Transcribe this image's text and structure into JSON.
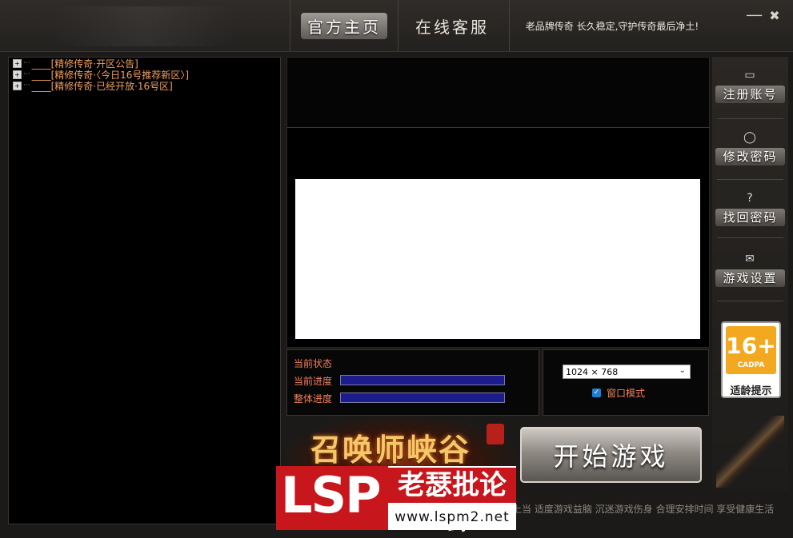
{
  "topbar": {
    "nav_home": "官方主页",
    "nav_service": "在线客服",
    "slogan": "老品牌传奇  长久稳定,守护传奇最后净土!"
  },
  "tree": {
    "items": [
      {
        "expander": "+",
        "label": "____[精修传奇·开区公告]"
      },
      {
        "expander": "+",
        "label": "____[精修传奇·〈今日16号推荐新区〉]"
      },
      {
        "expander": "+",
        "label": "____[精修传奇·已经开放·16号区]"
      }
    ]
  },
  "progress": {
    "status_label": "当前状态",
    "current_label": "当前进度",
    "overall_label": "整体进度",
    "current_value": 1.0,
    "overall_value": 1.0
  },
  "settings": {
    "resolution": "1024 × 768",
    "window_mode_label": "窗口模式",
    "window_mode_checked": true
  },
  "sidebar": {
    "items": [
      {
        "label": "注册账号",
        "icon": "monitor-icon"
      },
      {
        "label": "修改密码",
        "icon": "user-icon"
      },
      {
        "label": "找回密码",
        "icon": "question-icon"
      },
      {
        "label": "游戏设置",
        "icon": "chat-icon"
      }
    ]
  },
  "age_rating": {
    "number": "16+",
    "org": "CADPA",
    "label": "适龄提示"
  },
  "game_logo": "召唤师峡谷",
  "start_button": "开始游戏",
  "health_notice": "上当  适度游戏益脑  沉迷游戏伤身  合理安排时间  享受健康生活",
  "watermark": {
    "brand": "LSP",
    "name": "老瑟批论坛",
    "url": "www.lspm2.net"
  },
  "colors": {
    "accent_text": "#f08060",
    "progress_fill": "#1c1c8c",
    "age_badge": "#f2a81f",
    "watermark_red": "#c8161d"
  }
}
